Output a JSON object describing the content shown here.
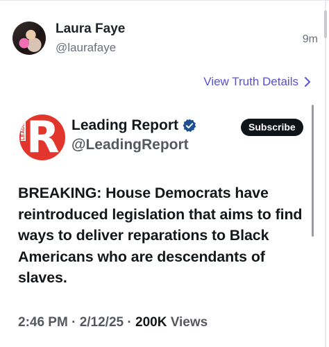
{
  "post": {
    "author_name": "Laura Faye",
    "author_handle": "@laurafaye",
    "time": "9m",
    "details_link": "View Truth Details"
  },
  "embed": {
    "account_name": "Leading Report",
    "account_handle": "@LeadingReport",
    "logo_letter": "R",
    "logo_text": "LEADING",
    "subscribe_label": "Subscribe",
    "body": "BREAKING: House Democrats have reintroduced legislation that aims to find ways to deliver reparations to Black Americans who are descendants of slaves.",
    "time": "2:46 PM",
    "date": "2/12/25",
    "views_count": "200K",
    "views_label": "Views",
    "verified_color": "#1d4f91",
    "logo_color": "#e2352b"
  },
  "colors": {
    "link": "#5a4fd6",
    "muted": "#6b6f7a"
  },
  "icons": {
    "verified": "verified-badge-icon",
    "chevron": "chevron-right-icon"
  }
}
